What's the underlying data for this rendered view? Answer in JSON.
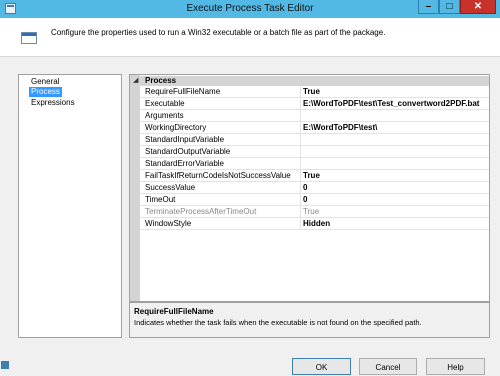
{
  "window": {
    "title": "Execute Process Task Editor",
    "min_glyph": "–",
    "max_glyph": "□",
    "close_glyph": "✕"
  },
  "header": {
    "text": "Configure the properties used to run a Win32 executable or a batch file as part of the package."
  },
  "nav": {
    "items": [
      {
        "label": "General"
      },
      {
        "label": "Process"
      },
      {
        "label": "Expressions"
      }
    ],
    "selected_index": 1
  },
  "grid": {
    "category": "Process",
    "toggle": "◢",
    "properties": [
      {
        "name": "RequireFullFileName",
        "value": "True"
      },
      {
        "name": "Executable",
        "value": "E:\\WordToPDF\\test\\Test_convertword2PDF.bat"
      },
      {
        "name": "Arguments",
        "value": ""
      },
      {
        "name": "WorkingDirectory",
        "value": "E:\\WordToPDF\\test\\"
      },
      {
        "name": "StandardInputVariable",
        "value": ""
      },
      {
        "name": "StandardOutputVariable",
        "value": ""
      },
      {
        "name": "StandardErrorVariable",
        "value": ""
      },
      {
        "name": "FailTaskIfReturnCodeIsNotSuccessValue",
        "value": "True"
      },
      {
        "name": "SuccessValue",
        "value": "0"
      },
      {
        "name": "TimeOut",
        "value": "0"
      },
      {
        "name": "TerminateProcessAfterTimeOut",
        "value": "True"
      },
      {
        "name": "WindowStyle",
        "value": "Hidden"
      }
    ]
  },
  "description": {
    "title": "RequireFullFileName",
    "text": "Indicates whether the task fails when the executable is not found on the specified path."
  },
  "buttons": {
    "ok": "OK",
    "cancel": "Cancel",
    "help": "Help"
  }
}
